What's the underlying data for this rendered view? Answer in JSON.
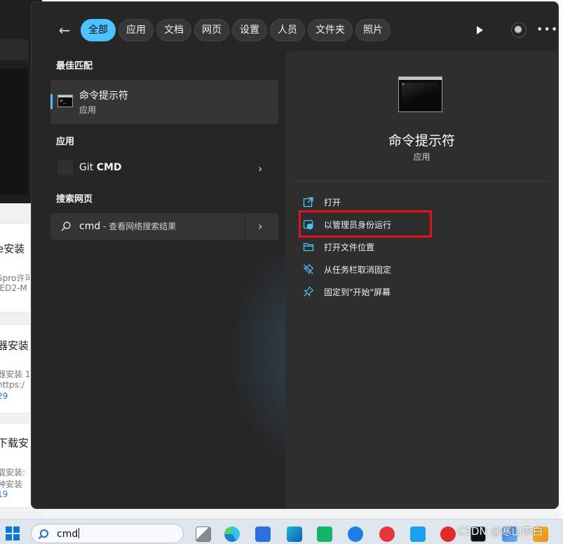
{
  "background": {
    "cards": [
      {
        "title": "e安装",
        "lines": [
          "5pro许可",
          "IED2-M"
        ],
        "num": ""
      },
      {
        "title": "器安装",
        "lines": [
          "器安装 1",
          " https:/"
        ],
        "num": "29"
      },
      {
        "title": "下载安",
        "lines": [
          "载安装:",
          "种安装"
        ],
        "num": "19"
      }
    ]
  },
  "filters": [
    "全部",
    "应用",
    "文档",
    "网页",
    "设置",
    "人员",
    "文件夹",
    "照片"
  ],
  "best_match": {
    "section": "最佳匹配",
    "name": "命令提示符",
    "type": "应用"
  },
  "apps": {
    "section": "应用",
    "item_prefix": "Git ",
    "item_bold": "CMD"
  },
  "web": {
    "section": "搜索网页",
    "query": "cmd",
    "hint": " - 查看网络搜索结果"
  },
  "detail": {
    "title": "命令提示符",
    "type": "应用",
    "actions": [
      "打开",
      "以管理员身份运行",
      "打开文件位置",
      "从任务栏取消固定",
      "固定到\"开始\"屏幕"
    ]
  },
  "taskbar": {
    "search_text": "cmd"
  },
  "watermark": "CSDN @寒山李白",
  "colors": {
    "accent": "#4cc2ff",
    "highlight_box": "#e0131f"
  }
}
